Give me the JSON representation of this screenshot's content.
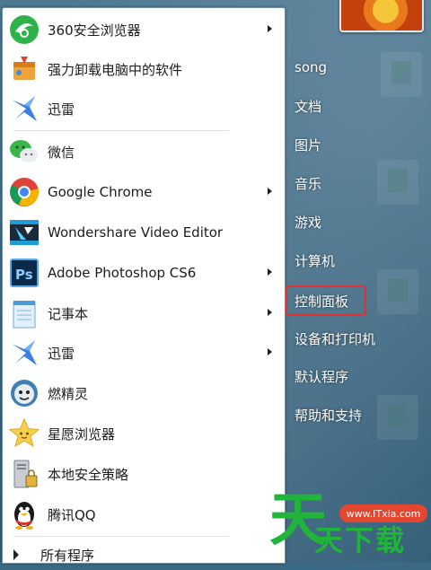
{
  "menu_items": [
    {
      "label": "360安全浏览器",
      "icon": "360-browser-icon",
      "has_submenu": true
    },
    {
      "label": "强力卸载电脑中的软件",
      "icon": "uninstall-box-icon",
      "has_submenu": false
    },
    {
      "label": "迅雷",
      "icon": "thunder-bird-icon",
      "has_submenu": false
    },
    {
      "label": "微信",
      "icon": "wechat-icon",
      "has_submenu": false
    },
    {
      "label": "Google Chrome",
      "icon": "chrome-icon",
      "has_submenu": true
    },
    {
      "label": "Wondershare Video Editor",
      "icon": "video-editor-icon",
      "has_submenu": false
    },
    {
      "label": "Adobe Photoshop CS6",
      "icon": "photoshop-icon",
      "has_submenu": true
    },
    {
      "label": "记事本",
      "icon": "notepad-icon",
      "has_submenu": true
    },
    {
      "label": "迅雷",
      "icon": "thunder-bird-icon",
      "has_submenu": true
    },
    {
      "label": "燃精灵",
      "icon": "sprite-face-icon",
      "has_submenu": false
    },
    {
      "label": "星愿浏览器",
      "icon": "star-face-icon",
      "has_submenu": false
    },
    {
      "label": "本地安全策略",
      "icon": "security-policy-icon",
      "has_submenu": false
    },
    {
      "label": "腾讯QQ",
      "icon": "qq-penguin-icon",
      "has_submenu": false
    }
  ],
  "all_programs": "所有程序",
  "right_items": [
    "song",
    "文档",
    "图片",
    "音乐",
    "游戏",
    "计算机",
    "控制面板",
    "设备和打印机",
    "默认程序",
    "帮助和支持"
  ],
  "highlighted": "控制面板",
  "watermark": {
    "big": "天",
    "text": "天下载",
    "url": "www.ITxia.com"
  },
  "colors": {
    "highlight": "#e23131",
    "watermark": "#20b43a"
  }
}
